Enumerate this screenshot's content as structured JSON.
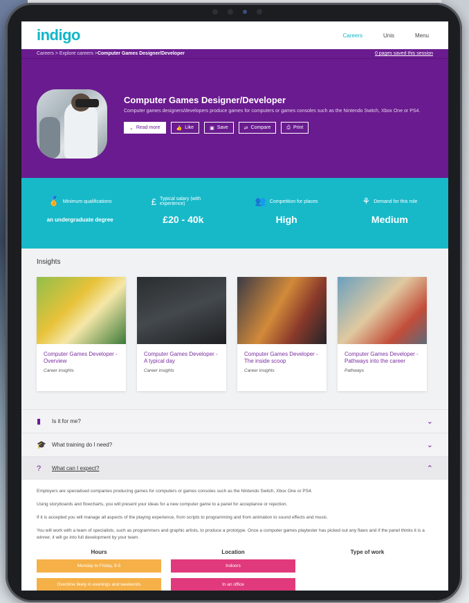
{
  "brand": {
    "logo": "indigo"
  },
  "topnav": {
    "items": [
      "Careers",
      "Unis",
      "Menu"
    ]
  },
  "breadcrumb": {
    "trail": "Careers > Explore careers > ",
    "current": "Computer Games Designer/Developer",
    "saved": "0 pages saved this session"
  },
  "hero": {
    "title": "Computer Games Designer/Developer",
    "description": "Computer games designers/developers produce games for computers or games consoles such as the Nintendo Switch, Xbox One or PS4.",
    "actions": [
      {
        "label": "Read more",
        "icon": "chevron-down-icon"
      },
      {
        "label": "Like",
        "icon": "thumbs-up-icon"
      },
      {
        "label": "Save",
        "icon": "save-icon"
      },
      {
        "label": "Compare",
        "icon": "compare-icon"
      },
      {
        "label": "Print",
        "icon": "print-icon"
      }
    ]
  },
  "stats": [
    {
      "label": "Minimum qualifications",
      "value": "an undergraduate degree",
      "icon": "award-icon"
    },
    {
      "label": "Typical salary (with experience)",
      "value": "£20 - 40k",
      "icon": "pound-icon"
    },
    {
      "label": "Competition for places",
      "value": "High",
      "icon": "people-icon"
    },
    {
      "label": "Demand for this role",
      "value": "Medium",
      "icon": "demand-icon"
    }
  ],
  "insights": {
    "title": "Insights",
    "cards": [
      {
        "title": "Computer Games Developer - Overview",
        "subtitle": "Career insights"
      },
      {
        "title": "Computer Games Developer - A typical day",
        "subtitle": "Career insights"
      },
      {
        "title": "Computer Games Developer - The inside scoop",
        "subtitle": "Career insights"
      },
      {
        "title": "Computer Games Developer - Pathways into the career",
        "subtitle": "Pathways"
      }
    ]
  },
  "accordion": [
    {
      "label": "Is it for me?",
      "icon": "book-icon",
      "open": false
    },
    {
      "label": "What training do I need?",
      "icon": "graduation-cap-icon",
      "open": false
    },
    {
      "label": "What can I expect?",
      "icon": "question-icon",
      "open": true
    }
  ],
  "expect": {
    "paragraphs": [
      "Employers are specialised companies producing games for computers or games consoles such as the Nintendo Switch, Xbox One or PS4.",
      "Using storyboards and flowcharts, you will present your ideas for a new computer game to a panel for acceptance or rejection.",
      "If it is accepted you will manage all aspects of the playing experience, from scripts to programming and from animation to sound effects and music.",
      "You will work with a team of specialists, such as programmers and graphic artists, to produce a prototype. Once a computer games playtester has picked out any flaws and if the panel thinks it is a winner, it will go into full development by your team."
    ],
    "columns": [
      {
        "heading": "Hours",
        "items": [
          "Monday to Friday, 9-5",
          "Overtime likely in evenings and weekends"
        ]
      },
      {
        "heading": "Location",
        "items": [
          "Indoors",
          "In an office"
        ]
      },
      {
        "heading": "Type of work",
        "items": []
      }
    ]
  },
  "colors": {
    "purple": "#6a1b8f",
    "teal": "#17b9c9",
    "orange": "#f5b048",
    "pink": "#e13a7c"
  }
}
